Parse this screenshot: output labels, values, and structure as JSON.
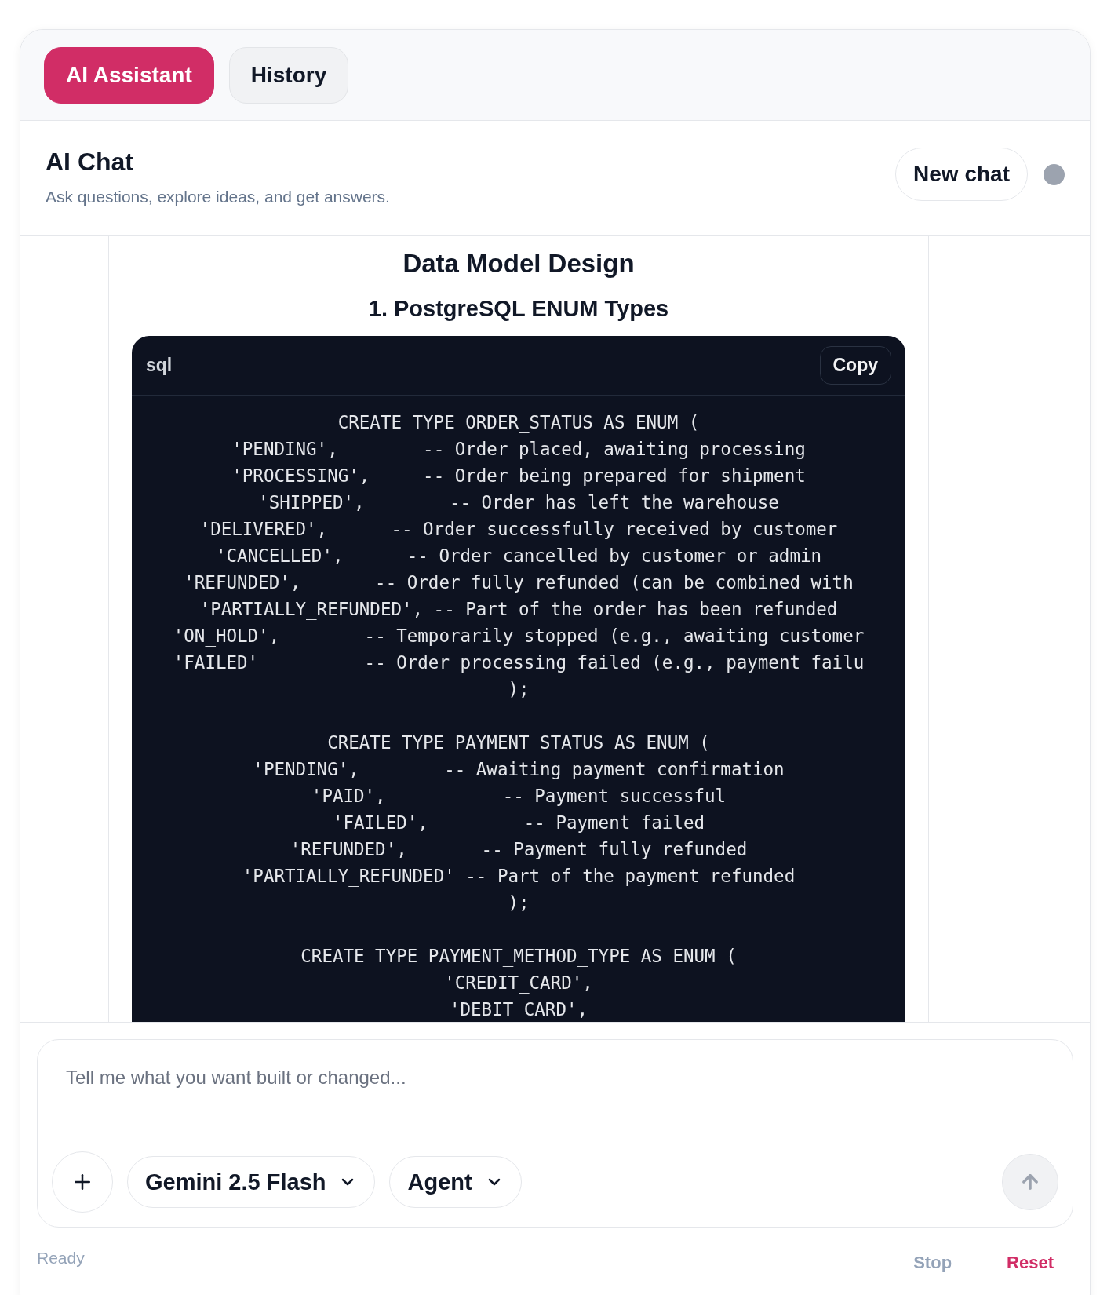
{
  "tabs": [
    {
      "label": "AI Assistant",
      "selected": true
    },
    {
      "label": "History",
      "selected": false
    }
  ],
  "header": {
    "title": "AI Chat",
    "subtitle": "Ask questions, explore ideas, and get answers.",
    "new_chat": "New chat"
  },
  "message": {
    "heading": "Data Model Design",
    "subheading": "1. PostgreSQL ENUM Types",
    "code": {
      "language": "sql",
      "copy": "Copy",
      "blocks": [
        {
          "lines": [
            "CREATE TYPE ORDER_STATUS AS ENUM (",
            "'PENDING',        -- Order placed, awaiting processing",
            "'PROCESSING',     -- Order being prepared for shipment",
            "'SHIPPED',        -- Order has left the warehouse",
            "'DELIVERED',      -- Order successfully received by customer",
            "'CANCELLED',      -- Order cancelled by customer or admin",
            "'REFUNDED',       -- Order fully refunded (can be combined with",
            "'PARTIALLY_REFUNDED', -- Part of the order has been refunded",
            "'ON_HOLD',        -- Temporarily stopped (e.g., awaiting customer",
            "'FAILED'          -- Order processing failed (e.g., payment failu",
            ");"
          ]
        },
        {
          "lines": [
            "CREATE TYPE PAYMENT_STATUS AS ENUM (",
            "'PENDING',        -- Awaiting payment confirmation",
            "'PAID',           -- Payment successful",
            "'FAILED',         -- Payment failed",
            "'REFUNDED',       -- Payment fully refunded",
            "'PARTIALLY_REFUNDED' -- Part of the payment refunded",
            ");"
          ]
        },
        {
          "lines": [
            "CREATE TYPE PAYMENT_METHOD_TYPE AS ENUM (",
            "'CREDIT_CARD',",
            "'DEBIT_CARD',"
          ]
        }
      ]
    }
  },
  "composer": {
    "placeholder": "Tell me what you want built or changed...",
    "model": "Gemini 2.5 Flash",
    "mode": "Agent",
    "send_disabled": true
  },
  "status": "Ready",
  "actions": [
    {
      "label": "Stop",
      "disabled": true
    },
    {
      "label": "Reset",
      "disabled": false
    }
  ]
}
